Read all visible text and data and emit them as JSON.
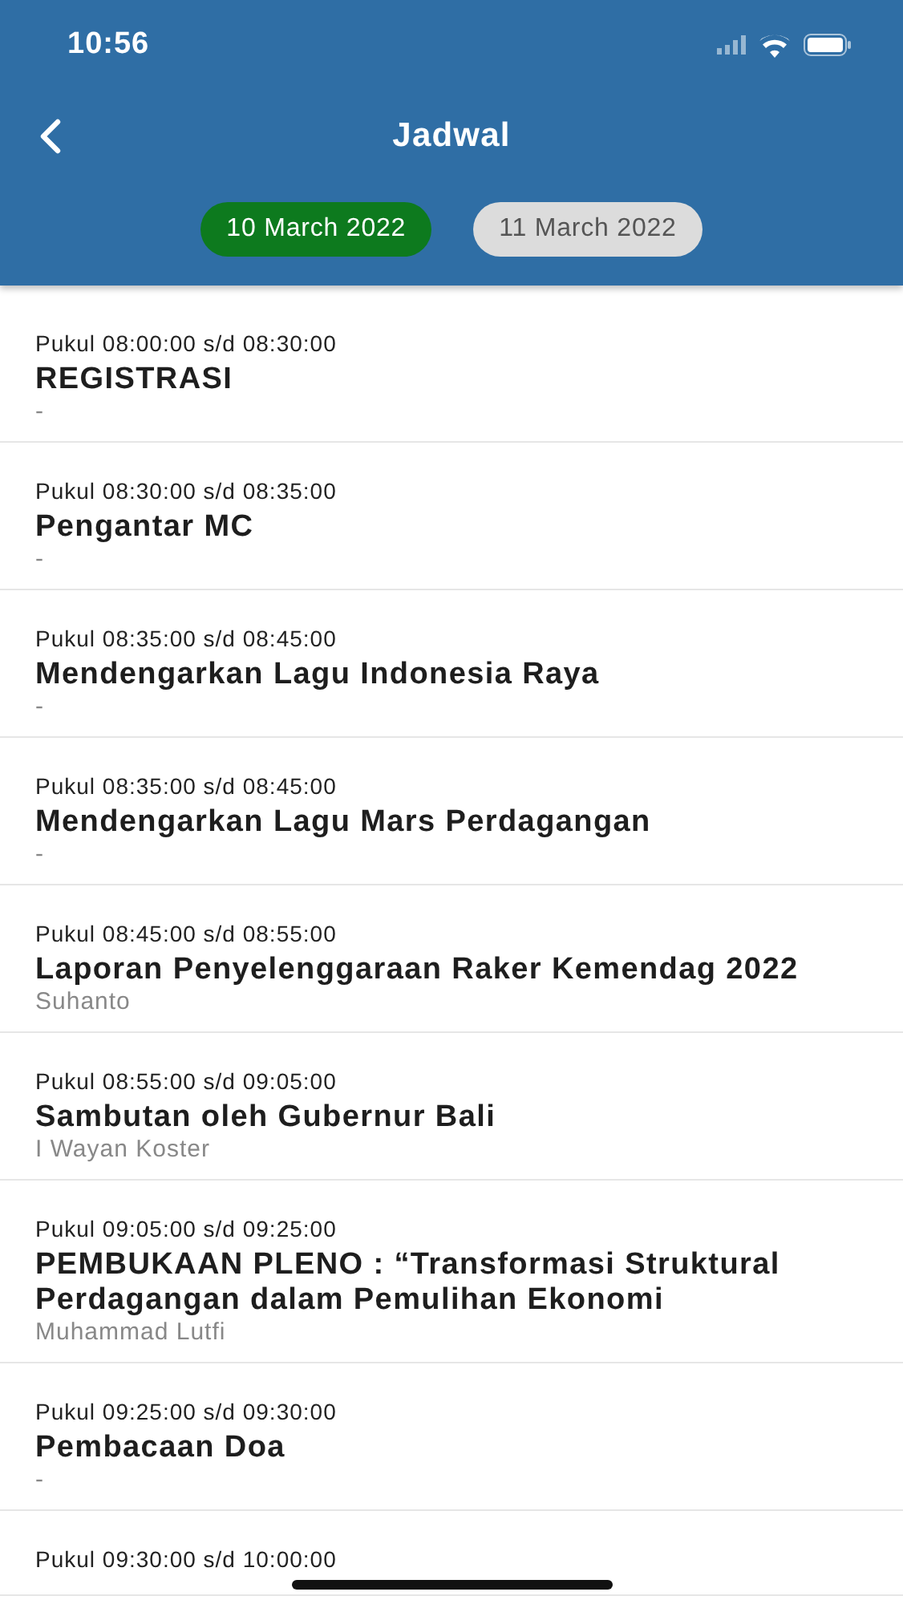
{
  "status_bar": {
    "time": "10:56"
  },
  "header": {
    "title": "Jadwal"
  },
  "dates": [
    {
      "label": "10 March 2022",
      "selected": true
    },
    {
      "label": "11 March 2022",
      "selected": false
    }
  ],
  "schedule": [
    {
      "time": "Pukul 08:00:00 s/d 08:30:00",
      "title": "REGISTRASI",
      "speaker": "-"
    },
    {
      "time": "Pukul 08:30:00 s/d 08:35:00",
      "title": "Pengantar MC",
      "speaker": "-"
    },
    {
      "time": "Pukul 08:35:00 s/d 08:45:00",
      "title": "Mendengarkan Lagu Indonesia Raya",
      "speaker": "-"
    },
    {
      "time": "Pukul 08:35:00 s/d 08:45:00",
      "title": "Mendengarkan Lagu Mars Perdagangan",
      "speaker": "-"
    },
    {
      "time": "Pukul 08:45:00 s/d 08:55:00",
      "title": "Laporan Penyelenggaraan Raker Kemendag 2022",
      "speaker": "Suhanto"
    },
    {
      "time": "Pukul 08:55:00 s/d 09:05:00",
      "title": "Sambutan oleh Gubernur Bali",
      "speaker": "I Wayan Koster"
    },
    {
      "time": "Pukul 09:05:00 s/d 09:25:00",
      "title": "PEMBUKAAN PLENO : “Transformasi Struktural Perdagangan dalam Pemulihan Ekonomi",
      "speaker": "Muhammad Lutfi"
    },
    {
      "time": "Pukul 09:25:00 s/d 09:30:00",
      "title": "Pembacaan Doa",
      "speaker": "-"
    },
    {
      "time": "Pukul 09:30:00 s/d 10:00:00"
    }
  ]
}
